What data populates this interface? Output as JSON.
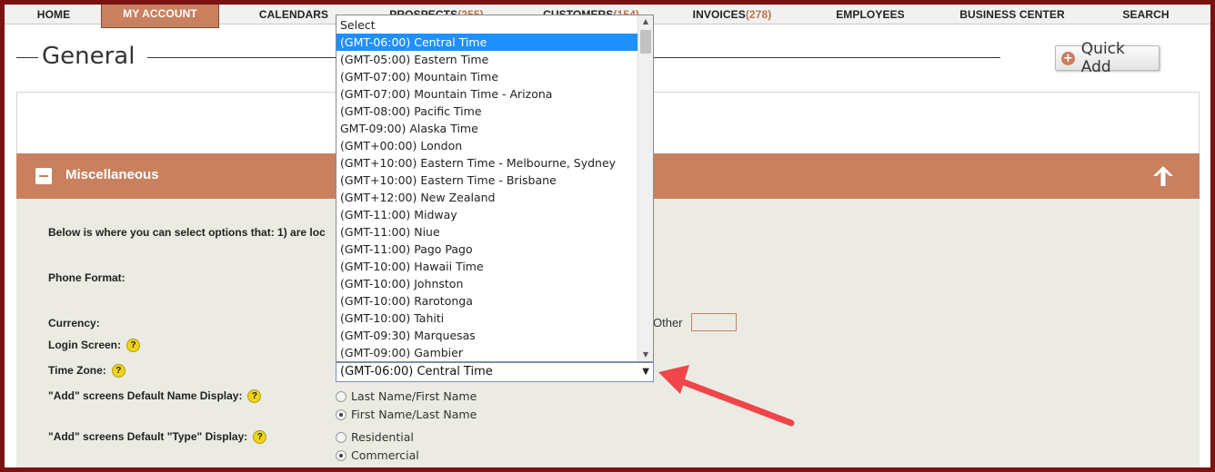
{
  "nav": {
    "items": [
      {
        "label": "HOME",
        "count": ""
      },
      {
        "label": "MY ACCOUNT",
        "count": ""
      },
      {
        "label": "CALENDARS",
        "count": ""
      },
      {
        "label": "PROSPECTS",
        "count": "(255)"
      },
      {
        "label": "CUSTOMERS",
        "count": "(154)"
      },
      {
        "label": "INVOICES",
        "count": "(278)"
      },
      {
        "label": "EMPLOYEES",
        "count": ""
      },
      {
        "label": "BUSINESS CENTER",
        "count": ""
      },
      {
        "label": "SEARCH",
        "count": ""
      }
    ]
  },
  "header": {
    "title": "General",
    "quick_add_label": "Quick Add",
    "quick_add_icon": "plus-circle-icon"
  },
  "misc": {
    "title": "Miscellaneous",
    "toggle_icon": "minus-icon",
    "collapse_icon": "arrow-up-icon",
    "intro": "Below is where you can select options that: 1) are loc",
    "phone_label": "Phone Format:",
    "currency_label": "Currency:",
    "other_label": "Other",
    "other_value": "",
    "login_label": "Login Screen:",
    "timezone_label": "Time Zone:",
    "name_display_label": "\"Add\" screens Default Name Display:",
    "type_display_label": "\"Add\" screens Default \"Type\" Display:",
    "help_glyph": "?"
  },
  "timezone": {
    "selected": "(GMT-06:00) Central Time",
    "options": [
      "Select",
      "(GMT-06:00) Central Time",
      "(GMT-05:00) Eastern Time",
      "(GMT-07:00) Mountain Time",
      "(GMT-07:00) Mountain Time - Arizona",
      "(GMT-08:00) Pacific Time",
      "GMT-09:00) Alaska Time",
      "(GMT+00:00) London",
      "(GMT+10:00) Eastern Time - Melbourne, Sydney",
      "(GMT+10:00) Eastern Time - Brisbane",
      "(GMT+12:00) New Zealand",
      "(GMT-11:00) Midway",
      "(GMT-11:00) Niue",
      "(GMT-11:00) Pago Pago",
      "(GMT-10:00) Hawaii Time",
      "(GMT-10:00) Johnston",
      "(GMT-10:00) Rarotonga",
      "(GMT-10:00) Tahiti",
      "(GMT-09:30) Marquesas",
      "(GMT-09:00) Gambier"
    ]
  },
  "name_display": {
    "options": [
      "Last Name/First Name",
      "First Name/Last Name"
    ],
    "selected_index": 1
  },
  "type_display": {
    "options": [
      "Residential",
      "Commercial"
    ],
    "selected_index": 1
  },
  "colors": {
    "frame": "#7a1212",
    "accent": "#c9805f",
    "body_bg": "#ebebe4",
    "selection": "#1e90ff",
    "annotation_arrow": "#f0454a"
  }
}
